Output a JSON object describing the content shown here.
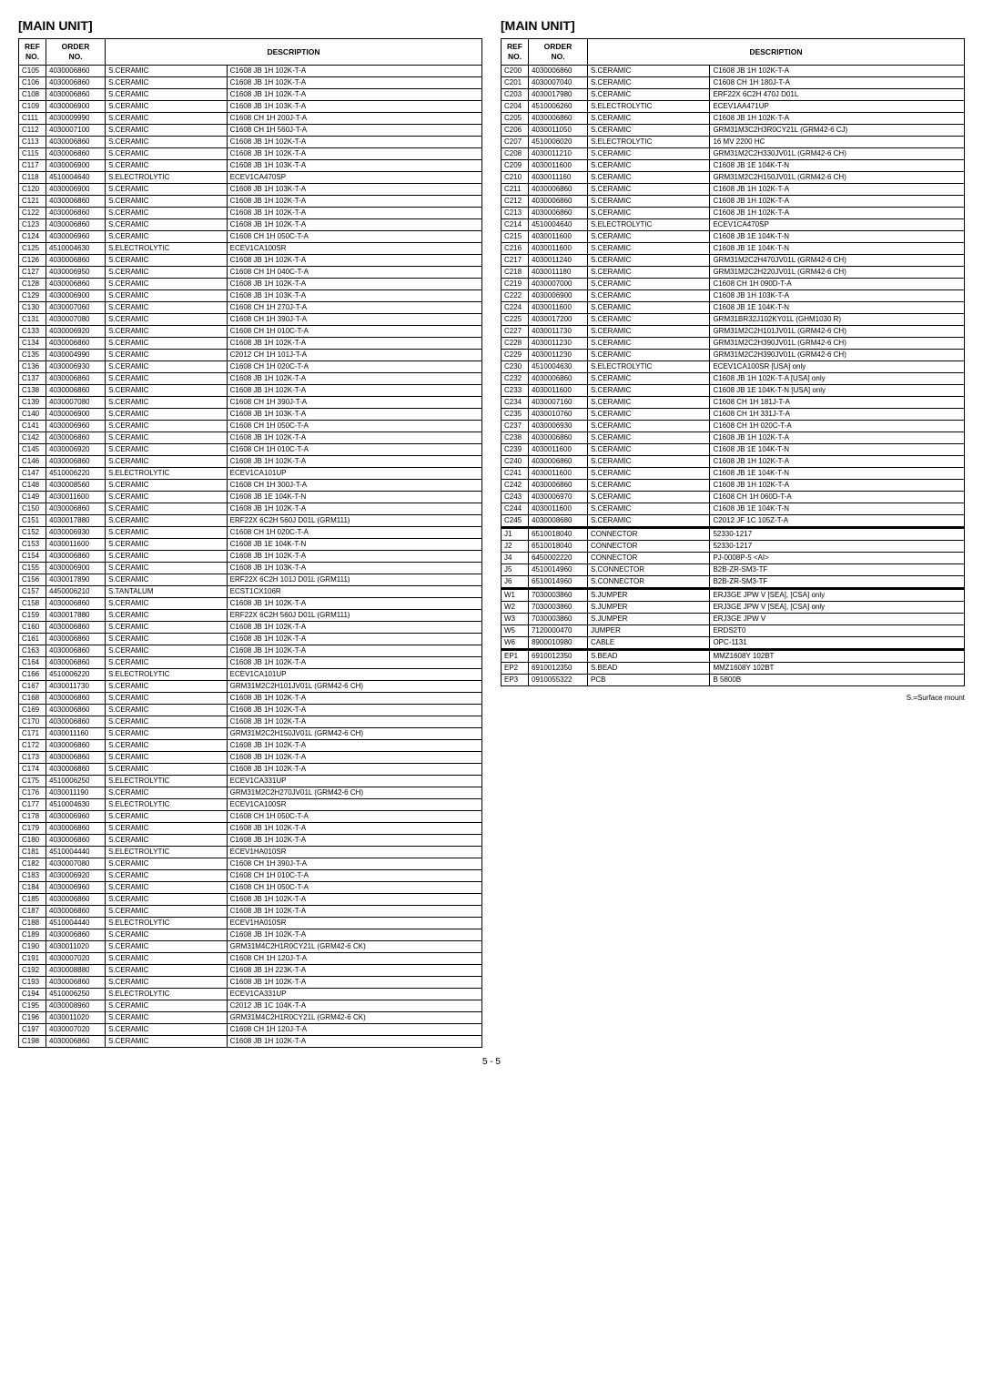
{
  "left_section": {
    "title": "[MAIN UNIT]",
    "headers": [
      "REF\nNO.",
      "ORDER\nNO.",
      "DESCRIPTION"
    ],
    "rows": [
      [
        "C105",
        "4030006860",
        "S.CERAMIC",
        "C1608 JB 1H 102K-T-A"
      ],
      [
        "C106",
        "4030006860",
        "S.CERAMIC",
        "C1608 JB 1H 102K-T-A"
      ],
      [
        "C108",
        "4030006860",
        "S.CERAMIC",
        "C1608 JB 1H 102K-T-A"
      ],
      [
        "C109",
        "4030006900",
        "S.CERAMIC",
        "C1608 JB 1H 103K-T-A"
      ],
      [
        "C111",
        "4030009990",
        "S.CERAMIC",
        "C1608 CH 1H 200J-T-A"
      ],
      [
        "C112",
        "4030007100",
        "S.CERAMIC",
        "C1608 CH 1H 560J-T-A"
      ],
      [
        "C113",
        "4030006860",
        "S.CERAMIC",
        "C1608 JB 1H 102K-T-A"
      ],
      [
        "C115",
        "4030006860",
        "S.CERAMIC",
        "C1608 JB 1H 102K-T-A"
      ],
      [
        "C117",
        "4030006900",
        "S.CERAMIC",
        "C1608 JB 1H 103K-T-A"
      ],
      [
        "C118",
        "4510004640",
        "S.ELECTROLYTIC",
        "ECEV1CA470SP"
      ],
      [
        "C120",
        "4030006900",
        "S.CERAMIC",
        "C1608 JB 1H 103K-T-A"
      ],
      [
        "C121",
        "4030006860",
        "S.CERAMIC",
        "C1608 JB 1H 102K-T-A"
      ],
      [
        "C122",
        "4030006860",
        "S.CERAMIC",
        "C1608 JB 1H 102K-T-A"
      ],
      [
        "C123",
        "4030006860",
        "S.CERAMIC",
        "C1608 JB 1H 102K-T-A"
      ],
      [
        "C124",
        "4030006960",
        "S.CERAMIC",
        "C1608 CH 1H 050C-T-A"
      ],
      [
        "C125",
        "4510004630",
        "S.ELECTROLYTIC",
        "ECEV1CA100SR"
      ],
      [
        "C126",
        "4030006860",
        "S.CERAMIC",
        "C1608 JB 1H 102K-T-A"
      ],
      [
        "C127",
        "4030006950",
        "S.CERAMIC",
        "C1608 CH 1H 040C-T-A"
      ],
      [
        "C128",
        "4030006860",
        "S.CERAMIC",
        "C1608 JB 1H 102K-T-A"
      ],
      [
        "C129",
        "4030006900",
        "S.CERAMIC",
        "C1608 JB 1H 103K-T-A"
      ],
      [
        "C130",
        "4030007060",
        "S.CERAMIC",
        "C1608 CH 1H 270J-T-A"
      ],
      [
        "C131",
        "4030007080",
        "S.CERAMIC",
        "C1608 CH 1H 390J-T-A"
      ],
      [
        "C133",
        "4030006920",
        "S.CERAMIC",
        "C1608 CH 1H 010C-T-A"
      ],
      [
        "C134",
        "4030006860",
        "S.CERAMIC",
        "C1608 JB 1H 102K-T-A"
      ],
      [
        "C135",
        "4030004990",
        "S.CERAMIC",
        "C2012 CH 1H 101J-T-A"
      ],
      [
        "C136",
        "4030006930",
        "S.CERAMIC",
        "C1608 CH 1H 020C-T-A"
      ],
      [
        "C137",
        "4030006860",
        "S.CERAMIC",
        "C1608 JB 1H 102K-T-A"
      ],
      [
        "C138",
        "4030006860",
        "S.CERAMIC",
        "C1608 JB 1H 102K-T-A"
      ],
      [
        "C139",
        "4030007080",
        "S.CERAMIC",
        "C1608 CH 1H 390J-T-A"
      ],
      [
        "C140",
        "4030006900",
        "S.CERAMIC",
        "C1608 JB 1H 103K-T-A"
      ],
      [
        "C141",
        "4030006960",
        "S.CERAMIC",
        "C1608 CH 1H 050C-T-A"
      ],
      [
        "C142",
        "4030006860",
        "S.CERAMIC",
        "C1608 JB 1H 102K-T-A"
      ],
      [
        "C145",
        "4030006920",
        "S.CERAMIC",
        "C1608 CH 1H 010C-T-A"
      ],
      [
        "C146",
        "4030006860",
        "S.CERAMIC",
        "C1608 JB 1H 102K-T-A"
      ],
      [
        "C147",
        "4510006220",
        "S.ELECTROLYTIC",
        "ECEV1CA101UP"
      ],
      [
        "C148",
        "4030008560",
        "S.CERAMIC",
        "C1608 CH 1H 300J-T-A"
      ],
      [
        "C149",
        "4030011600",
        "S.CERAMIC",
        "C1608 JB 1E 104K-T-N"
      ],
      [
        "C150",
        "4030006860",
        "S.CERAMIC",
        "C1608 JB 1H 102K-T-A"
      ],
      [
        "C151",
        "4030017880",
        "S.CERAMIC",
        "ERF22X 6C2H 560J D01L (GRM111)"
      ],
      [
        "C152",
        "4030006930",
        "S.CERAMIC",
        "C1608 CH 1H 020C-T-A"
      ],
      [
        "C153",
        "4030011600",
        "S.CERAMIC",
        "C1608 JB 1E 104K-T-N"
      ],
      [
        "C154",
        "4030006860",
        "S.CERAMIC",
        "C1608 JB 1H 102K-T-A"
      ],
      [
        "C155",
        "4030006900",
        "S.CERAMIC",
        "C1608 JB 1H 103K-T-A"
      ],
      [
        "C156",
        "4030017890",
        "S.CERAMIC",
        "ERF22X 6C2H 101J D01L (GRM111)"
      ],
      [
        "C157",
        "4450006210",
        "S.TANTALUM",
        "ECST1CX106R"
      ],
      [
        "C158",
        "4030006860",
        "S.CERAMIC",
        "C1608 JB 1H 102K-T-A"
      ],
      [
        "C159",
        "4030017880",
        "S.CERAMIC",
        "ERF22X 6C2H 560J D01L (GRM111)"
      ],
      [
        "C160",
        "4030006860",
        "S.CERAMIC",
        "C1608 JB 1H 102K-T-A"
      ],
      [
        "C161",
        "4030006860",
        "S.CERAMIC",
        "C1608 JB 1H 102K-T-A"
      ],
      [
        "C163",
        "4030006860",
        "S.CERAMIC",
        "C1608 JB 1H 102K-T-A"
      ],
      [
        "C164",
        "4030006860",
        "S.CERAMIC",
        "C1608 JB 1H 102K-T-A"
      ],
      [
        "C166",
        "4510006220",
        "S.ELECTROLYTIC",
        "ECEV1CA101UP"
      ],
      [
        "C167",
        "4030011730",
        "S.CERAMIC",
        "GRM31M2C2H101JV01L (GRM42-6 CH)"
      ],
      [
        "C168",
        "4030006860",
        "S.CERAMIC",
        "C1608 JB 1H 102K-T-A"
      ],
      [
        "C169",
        "4030006860",
        "S.CERAMIC",
        "C1608 JB 1H 102K-T-A"
      ],
      [
        "C170",
        "4030006860",
        "S.CERAMIC",
        "C1608 JB 1H 102K-T-A"
      ],
      [
        "C171",
        "4030011160",
        "S.CERAMIC",
        "GRM31M2C2H150JV01L (GRM42-6 CH)"
      ],
      [
        "C172",
        "4030006860",
        "S.CERAMIC",
        "C1608 JB 1H 102K-T-A"
      ],
      [
        "C173",
        "4030006860",
        "S.CERAMIC",
        "C1608 JB 1H 102K-T-A"
      ],
      [
        "C174",
        "4030006860",
        "S.CERAMIC",
        "C1608 JB 1H 102K-T-A"
      ],
      [
        "C175",
        "4510006250",
        "S.ELECTROLYTIC",
        "ECEV1CA331UP"
      ],
      [
        "C176",
        "4030011190",
        "S.CERAMIC",
        "GRM31M2C2H270JV01L (GRM42-6 CH)"
      ],
      [
        "C177",
        "4510004630",
        "S.ELECTROLYTIC",
        "ECEV1CA100SR"
      ],
      [
        "C178",
        "4030006960",
        "S.CERAMIC",
        "C1608 CH 1H 050C-T-A"
      ],
      [
        "C179",
        "4030006860",
        "S.CERAMIC",
        "C1608 JB 1H 102K-T-A"
      ],
      [
        "C180",
        "4030006860",
        "S.CERAMIC",
        "C1608 JB 1H 102K-T-A"
      ],
      [
        "C181",
        "4510004440",
        "S.ELECTROLYTIC",
        "ECEV1HA010SR"
      ],
      [
        "C182",
        "4030007080",
        "S.CERAMIC",
        "C1608 CH 1H 390J-T-A"
      ],
      [
        "C183",
        "4030006920",
        "S.CERAMIC",
        "C1608 CH 1H 010C-T-A"
      ],
      [
        "C184",
        "4030006960",
        "S.CERAMIC",
        "C1608 CH 1H 050C-T-A"
      ],
      [
        "C185",
        "4030006860",
        "S.CERAMIC",
        "C1608 JB 1H 102K-T-A"
      ],
      [
        "C187",
        "4030006860",
        "S.CERAMIC",
        "C1608 JB 1H 102K-T-A"
      ],
      [
        "C188",
        "4510004440",
        "S.ELECTROLYTIC",
        "ECEV1HA010SR"
      ],
      [
        "C189",
        "4030006860",
        "S.CERAMIC",
        "C1608 JB 1H 102K-T-A"
      ],
      [
        "C190",
        "4030011020",
        "S.CERAMIC",
        "GRM31M4C2H1R0CY21L (GRM42-6 CK)"
      ],
      [
        "C191",
        "4030007020",
        "S.CERAMIC",
        "C1608 CH 1H 120J-T-A"
      ],
      [
        "C192",
        "4030008880",
        "S.CERAMIC",
        "C1608 JB 1H 223K-T-A"
      ],
      [
        "C193",
        "4030006860",
        "S.CERAMIC",
        "C1608 JB 1H 102K-T-A"
      ],
      [
        "C194",
        "4510006250",
        "S.ELECTROLYTIC",
        "ECEV1CA331UP"
      ],
      [
        "C195",
        "4030008960",
        "S.CERAMIC",
        "C2012 JB 1C 104K-T-A"
      ],
      [
        "C196",
        "4030011020",
        "S.CERAMIC",
        "GRM31M4C2H1R0CY21L (GRM42-6 CK)"
      ],
      [
        "C197",
        "4030007020",
        "S.CERAMIC",
        "C1608 CH 1H 120J-T-A"
      ],
      [
        "C198",
        "4030006860",
        "S.CERAMIC",
        "C1608 JB 1H 102K-T-A"
      ]
    ]
  },
  "right_section": {
    "title": "[MAIN UNIT]",
    "headers": [
      "REF\nNO.",
      "ORDER\nNO.",
      "DESCRIPTION"
    ],
    "rows": [
      [
        "C200",
        "4030006860",
        "S.CERAMIC",
        "C1608 JB 1H 102K-T-A"
      ],
      [
        "C201",
        "4030007040",
        "S.CERAMIC",
        "C1608 CH 1H 180J-T-A"
      ],
      [
        "C203",
        "4030017980",
        "S.CERAMIC",
        "ERF22X 6C2H 470J D01L"
      ],
      [
        "C204",
        "4510006260",
        "S.ELECTROLYTIC",
        "ECEV1AA471UP"
      ],
      [
        "C205",
        "4030006860",
        "S.CERAMIC",
        "C1608 JB 1H 102K-T-A"
      ],
      [
        "C206",
        "4030011050",
        "S.CERAMIC",
        "GRM31M3C2H3R0CY21L (GRM42-6 CJ)"
      ],
      [
        "C207",
        "4510006020",
        "S.ELECTROLYTIC",
        "16 MV 2200 HC"
      ],
      [
        "C208",
        "4030011210",
        "S.CERAMIC",
        "GRM31M2C2H330JV01L (GRM42-6 CH)"
      ],
      [
        "C209",
        "4030011600",
        "S.CERAMIC",
        "C1608 JB 1E 104K-T-N"
      ],
      [
        "C210",
        "4030011160",
        "S.CERAMIC",
        "GRM31M2C2H150JV01L (GRM42-6 CH)"
      ],
      [
        "C211",
        "4030006860",
        "S.CERAMIC",
        "C1608 JB 1H 102K-T-A"
      ],
      [
        "C212",
        "4030006860",
        "S.CERAMIC",
        "C1608 JB 1H 102K-T-A"
      ],
      [
        "C213",
        "4030006860",
        "S.CERAMIC",
        "C1608 JB 1H 102K-T-A"
      ],
      [
        "C214",
        "4510004640",
        "S.ELECTROLYTIC",
        "ECEV1CA470SP"
      ],
      [
        "C215",
        "4030011600",
        "S.CERAMIC",
        "C1608 JB 1E 104K-T-N"
      ],
      [
        "C216",
        "4030011600",
        "S.CERAMIC",
        "C1608 JB 1E 104K-T-N"
      ],
      [
        "C217",
        "4030011240",
        "S.CERAMIC",
        "GRM31M2C2H470JV01L (GRM42-6 CH)"
      ],
      [
        "C218",
        "4030011180",
        "S.CERAMIC",
        "GRM31M2C2H220JV01L (GRM42-6 CH)"
      ],
      [
        "C219",
        "4030007000",
        "S.CERAMIC",
        "C1608 CH 1H 090D-T-A"
      ],
      [
        "C222",
        "4030006900",
        "S.CERAMIC",
        "C1608 JB 1H 103K-T-A"
      ],
      [
        "C224",
        "4030011600",
        "S.CERAMIC",
        "C1608 JB 1E 104K-T-N"
      ],
      [
        "C225",
        "4030017200",
        "S.CERAMIC",
        "GRM31BR32J102KY01L (GHM1030 R)"
      ],
      [
        "C227",
        "4030011730",
        "S.CERAMIC",
        "GRM31M2C2H101JV01L (GRM42-6 CH)"
      ],
      [
        "C228",
        "4030011230",
        "S.CERAMIC",
        "GRM31M2C2H390JV01L (GRM42-6 CH)"
      ],
      [
        "C229",
        "4030011230",
        "S.CERAMIC",
        "GRM31M2C2H390JV01L (GRM42-6 CH)"
      ],
      [
        "C230",
        "4510004630",
        "S.ELECTROLYTIC",
        "ECEV1CA100SR   [USA] only"
      ],
      [
        "C232",
        "4030006860",
        "S.CERAMIC",
        "C1608 JB 1H 102K-T-A  [USA] only"
      ],
      [
        "C233",
        "4030011600",
        "S.CERAMIC",
        "C1608 JB 1E 104K-T-N  [USA] only"
      ],
      [
        "C234",
        "4030007160",
        "S.CERAMIC",
        "C1608 CH 1H 181J-T-A"
      ],
      [
        "C235",
        "4030010760",
        "S.CERAMIC",
        "C1608 CH 1H 331J-T-A"
      ],
      [
        "C237",
        "4030006930",
        "S.CERAMIC",
        "C1608 CH 1H 020C-T-A"
      ],
      [
        "C238",
        "4030006860",
        "S.CERAMIC",
        "C1608 JB 1H 102K-T-A"
      ],
      [
        "C239",
        "4030011600",
        "S.CERAMIC",
        "C1608 JB 1E 104K-T-N"
      ],
      [
        "C240",
        "4030006860",
        "S.CERAMIC",
        "C1608 JB 1H 102K-T-A"
      ],
      [
        "C241",
        "4030011600",
        "S.CERAMIC",
        "C1608 JB 1E 104K-T-N"
      ],
      [
        "C242",
        "4030006860",
        "S.CERAMIC",
        "C1608 JB 1H 102K-T-A"
      ],
      [
        "C243",
        "4030006970",
        "S.CERAMIC",
        "C1608 CH 1H 060D-T-A"
      ],
      [
        "C244",
        "4030011600",
        "S.CERAMIC",
        "C1608 JB 1E 104K-T-N"
      ],
      [
        "C245",
        "4030008680",
        "S.CERAMIC",
        "C2012 JF 1C 105Z-T-A"
      ],
      [
        "J1",
        "6510018040",
        "CONNECTOR",
        "52330-1217"
      ],
      [
        "J2",
        "6510018040",
        "CONNECTOR",
        "52330-1217"
      ],
      [
        "J4",
        "6450002220",
        "CONNECTOR",
        "PJ-0008P-5 <AI>"
      ],
      [
        "J5",
        "4510014960",
        "S.CONNECTOR",
        "B2B-ZR-SM3-TF"
      ],
      [
        "J6",
        "6510014960",
        "S.CONNECTOR",
        "B2B-ZR-SM3-TF"
      ],
      [
        "W1",
        "7030003860",
        "S.JUMPER",
        "ERJ3GE JPW V   [SEA], [CSA] only"
      ],
      [
        "W2",
        "7030003860",
        "S.JUMPER",
        "ERJ3GE JPW V   [SEA], [CSA] only"
      ],
      [
        "W3",
        "7030003860",
        "S.JUMPER",
        "ERJ3GE JPW V"
      ],
      [
        "W5",
        "7120000470",
        "JUMPER",
        "ERDS2T0"
      ],
      [
        "W6",
        "8900010980",
        "CABLE",
        "OPC-1131"
      ],
      [
        "EP1",
        "6910012350",
        "S.BEAD",
        "MMZ1608Y 102BT"
      ],
      [
        "EP2",
        "6910012350",
        "S.BEAD",
        "MMZ1608Y 102BT"
      ],
      [
        "EP3",
        "0910055322",
        "PCB",
        "B 5800B"
      ]
    ],
    "separator_before": [
      "J1",
      "W1",
      "EP1"
    ]
  },
  "footer": {
    "page": "5 - 5",
    "note": "S.=Surface mount"
  }
}
